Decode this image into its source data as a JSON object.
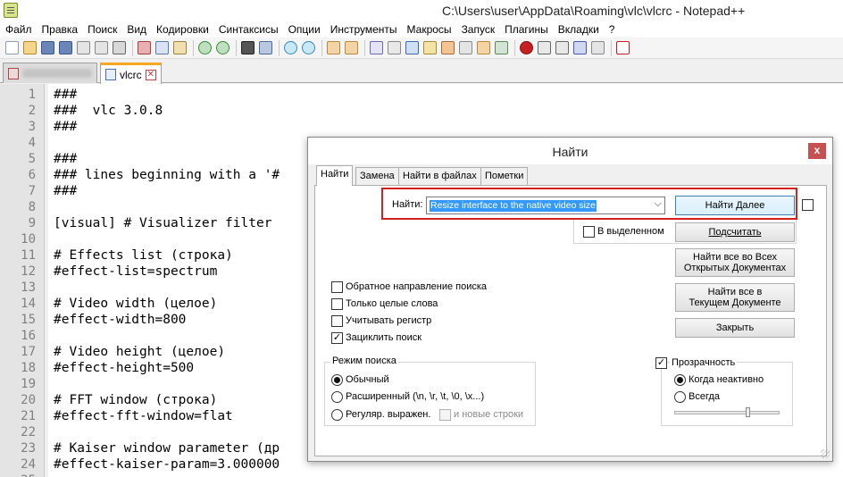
{
  "window": {
    "title": "C:\\Users\\user\\AppData\\Roaming\\vlc\\vlcrc - Notepad++"
  },
  "menu": [
    "Файл",
    "Правка",
    "Поиск",
    "Вид",
    "Кодировки",
    "Синтаксисы",
    "Опции",
    "Инструменты",
    "Макросы",
    "Запуск",
    "Плагины",
    "Вкладки",
    "?"
  ],
  "tabs": {
    "active_label": "vlcrc",
    "close_glyph": "✕"
  },
  "editor": {
    "lines": [
      {
        "n": "1",
        "text": "###"
      },
      {
        "n": "2",
        "text": "###  vlc 3.0.8"
      },
      {
        "n": "3",
        "text": "###"
      },
      {
        "n": "4",
        "text": ""
      },
      {
        "n": "5",
        "text": "###"
      },
      {
        "n": "6",
        "text": "### lines beginning with a '#"
      },
      {
        "n": "7",
        "text": "###"
      },
      {
        "n": "8",
        "text": ""
      },
      {
        "n": "9",
        "text": "[visual] # Visualizer filter"
      },
      {
        "n": "10",
        "text": ""
      },
      {
        "n": "11",
        "text": "# Effects list (строка)"
      },
      {
        "n": "12",
        "text": "#effect-list=spectrum"
      },
      {
        "n": "13",
        "text": ""
      },
      {
        "n": "14",
        "text": "# Video width (целое)"
      },
      {
        "n": "15",
        "text": "#effect-width=800"
      },
      {
        "n": "16",
        "text": ""
      },
      {
        "n": "17",
        "text": "# Video height (целое)"
      },
      {
        "n": "18",
        "text": "#effect-height=500"
      },
      {
        "n": "19",
        "text": ""
      },
      {
        "n": "20",
        "text": "# FFT window (строка)"
      },
      {
        "n": "21",
        "text": "#effect-fft-window=flat"
      },
      {
        "n": "22",
        "text": ""
      },
      {
        "n": "23",
        "text": "# Kaiser window parameter (др"
      },
      {
        "n": "24",
        "text": "#effect-kaiser-param=3.000000"
      },
      {
        "n": "25",
        "text": ""
      }
    ]
  },
  "dialog": {
    "title": "Найти",
    "close_glyph": "x",
    "tabs": [
      "Найти",
      "Замена",
      "Найти в файлах",
      "Пометки"
    ],
    "find_label": "Найти:",
    "find_value": "Resize interface to the native video size",
    "dropdown_glyph": "⌵",
    "in_selection": "В выделенном",
    "buttons": {
      "find_next": "Найти Далее",
      "count": "Подсчитать",
      "find_all_open_1": "Найти все во Всех",
      "find_all_open_2": "Открытых Документах",
      "find_all_current_1": "Найти все в",
      "find_all_current_2": "Текущем Документе",
      "close": "Закрыть"
    },
    "options": {
      "backward": "Обратное направление поиска",
      "whole_word": "Только целые слова",
      "match_case": "Учитывать регистр",
      "wrap": "Зациклить поиск"
    },
    "wrap_checked": true,
    "search_mode": {
      "title": "Режим поиска",
      "normal": "Обычный",
      "extended": "Расширенный (\\n, \\r, \\t, \\0, \\x...)",
      "regex": "Регуляр. выражен.",
      "newline": "и новые строки",
      "selected": "normal"
    },
    "transparency": {
      "title": "Прозрачность",
      "checked": true,
      "on_lose_focus": "Когда неактивно",
      "always": "Всегда",
      "selected": "on_lose_focus",
      "level_fraction": 0.7
    },
    "check_glyph": "✓"
  }
}
